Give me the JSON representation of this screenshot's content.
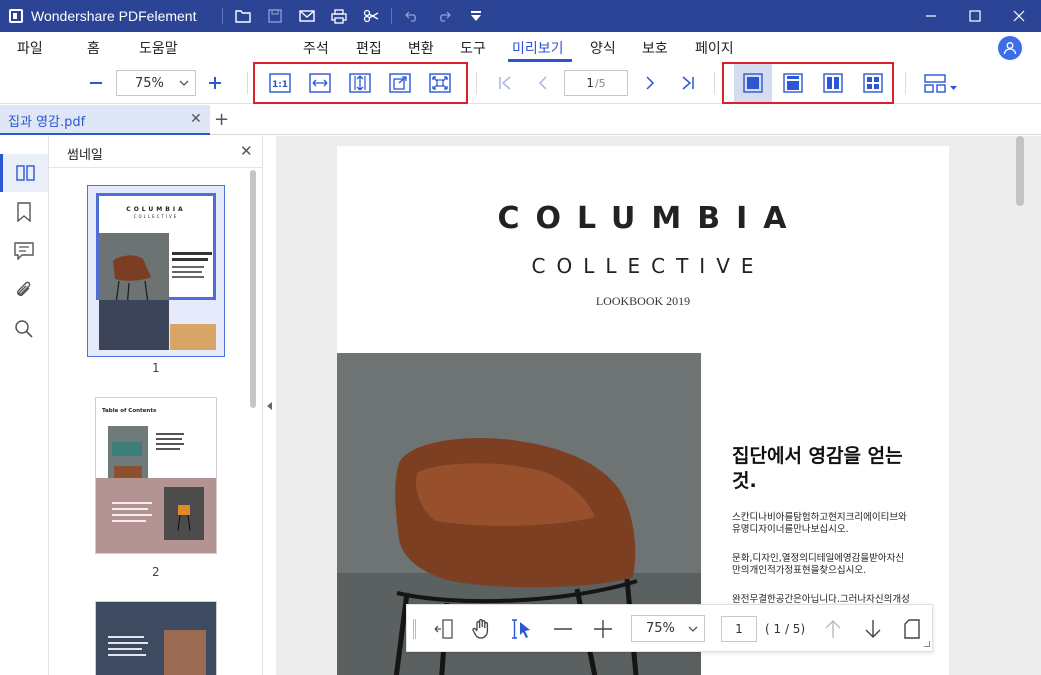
{
  "app": {
    "title": "Wondershare PDFelement"
  },
  "quick_access": [
    "open-folder-icon",
    "save-icon",
    "email-icon",
    "print-icon",
    "cut-icon",
    "undo-icon",
    "redo-icon",
    "dropdown-icon"
  ],
  "menu": {
    "items": [
      "파일",
      "홈",
      "도움말",
      "주석",
      "편집",
      "변환",
      "도구",
      "미리보기",
      "양식",
      "보호",
      "페이지"
    ],
    "active": "미리보기"
  },
  "toolbar": {
    "zoom": "75%",
    "page_current": "1",
    "page_total": "/5"
  },
  "tab": {
    "label": "집과 영감.pdf"
  },
  "thumbnails": {
    "title": "썸네일",
    "pages": [
      "1",
      "2"
    ],
    "toc_title": "Table of Contents"
  },
  "document": {
    "title": "COLUMBIA",
    "subtitle": "COLLECTIVE",
    "small": "LOOKBOOK 2019",
    "heading": "집단에서 영감을 얻는것.",
    "para1": "스칸디나비아를탐험하고현지크리에이티브와유명디자이너를만나보십시오.",
    "para2": "문화,디자인,열정의디테일에영감을받아자신만의개인적가정표현을찾으십시오.",
    "para3": "완전무결한공간은아닙니다.그러나자신의개성을표현하십시오."
  },
  "floating_bar": {
    "zoom": "75%",
    "page": "1",
    "total": "( 1 / 5)"
  },
  "colors": {
    "titlebar": "#2b4495",
    "accent": "#2b56d4",
    "highlight_box": "#d9202b",
    "viewer_bg": "#ededed"
  }
}
